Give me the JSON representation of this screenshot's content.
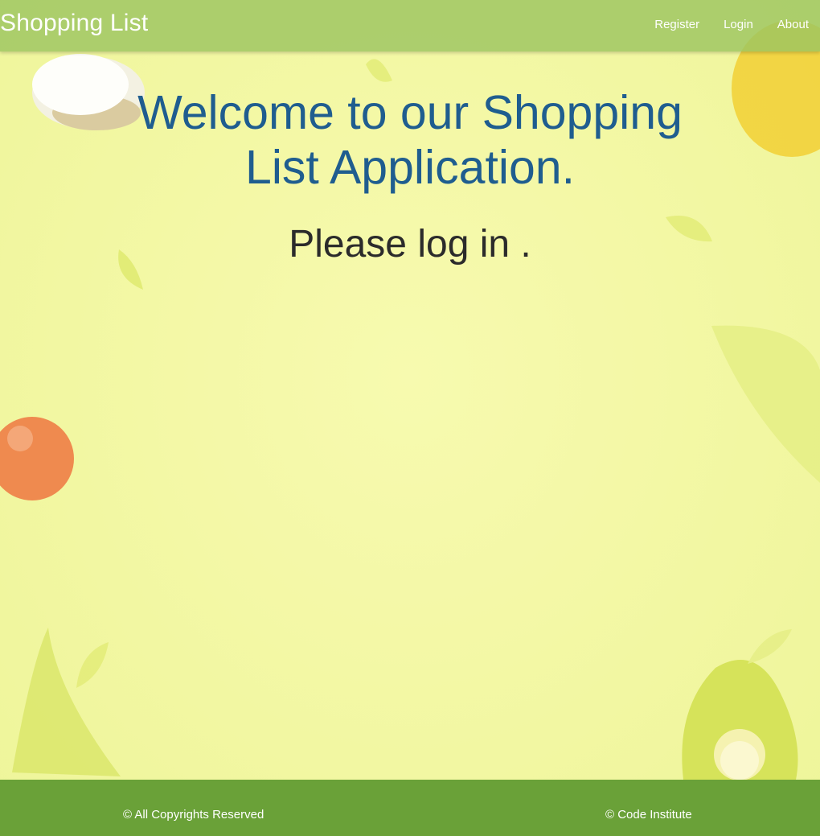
{
  "navbar": {
    "brand": "Shopping List",
    "links": [
      {
        "label": "Register"
      },
      {
        "label": "Login"
      },
      {
        "label": "About"
      }
    ],
    "color": "#9cc460"
  },
  "main": {
    "welcome": "Welcome to our Shopping List Application.",
    "prompt": "Please log in ."
  },
  "footer": {
    "left_text": "© All Copyrights Reserved",
    "right_text": "© Code Institute",
    "color": "#6aa138"
  },
  "theme": {
    "background": "#f3f8a6",
    "heading_color": "#1f5d8f"
  }
}
